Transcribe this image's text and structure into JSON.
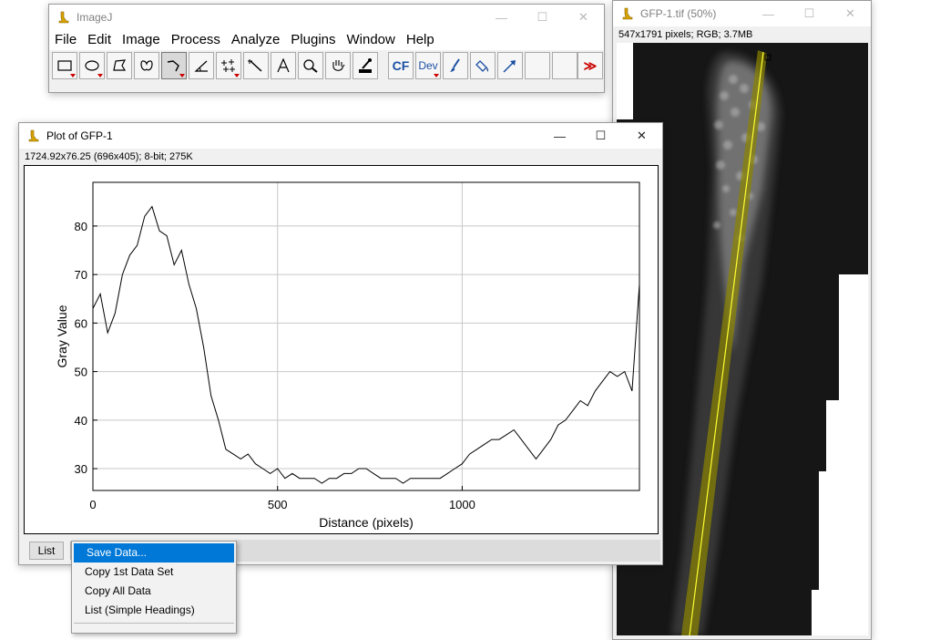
{
  "imagej": {
    "title": "ImageJ",
    "menus": [
      "File",
      "Edit",
      "Image",
      "Process",
      "Analyze",
      "Plugins",
      "Window",
      "Help"
    ],
    "tool_cf": "CF",
    "tool_dev": "Dev",
    "overflow": "≫"
  },
  "image_window": {
    "title": "GFP-1.tif (50%)",
    "info": "547x1791 pixels; RGB; 3.7MB"
  },
  "plot_window": {
    "title": "Plot of GFP-1",
    "info": "1724.92x76.25   (696x405); 8-bit; 275K",
    "list_button": "List"
  },
  "context_menu": {
    "items": [
      "Save Data...",
      "Copy 1st Data Set",
      "Copy All Data",
      "List (Simple Headings)"
    ],
    "selected_index": 0
  },
  "chart_data": {
    "type": "line",
    "xlabel": "Distance (pixels)",
    "ylabel": "Gray Value",
    "xlim": [
      0,
      1480
    ],
    "ylim": [
      25.5,
      89
    ],
    "xticks": [
      0,
      500,
      1000
    ],
    "yticks": [
      30,
      40,
      50,
      60,
      70,
      80
    ],
    "grid": true,
    "series": [
      {
        "x": [
          0,
          20,
          40,
          60,
          80,
          100,
          120,
          140,
          160,
          180,
          200,
          220,
          240,
          260,
          280,
          300,
          320,
          340,
          360,
          380,
          400,
          420,
          440,
          460,
          480,
          500,
          520,
          540,
          560,
          580,
          600,
          620,
          640,
          660,
          680,
          700,
          720,
          740,
          760,
          780,
          800,
          820,
          840,
          860,
          880,
          900,
          920,
          940,
          960,
          980,
          1000,
          1020,
          1040,
          1060,
          1080,
          1100,
          1120,
          1140,
          1160,
          1180,
          1200,
          1220,
          1240,
          1260,
          1280,
          1300,
          1320,
          1340,
          1360,
          1380,
          1400,
          1420,
          1440,
          1460,
          1480
        ],
        "values": [
          63,
          66,
          58,
          62,
          70,
          74,
          76,
          82,
          84,
          79,
          78,
          72,
          75,
          68,
          63,
          55,
          45,
          40,
          34,
          33,
          32,
          33,
          31,
          30,
          29,
          30,
          28,
          29,
          28,
          28,
          28,
          27,
          28,
          28,
          29,
          29,
          30,
          30,
          29,
          28,
          28,
          28,
          27,
          28,
          28,
          28,
          28,
          28,
          29,
          30,
          31,
          33,
          34,
          35,
          36,
          36,
          37,
          38,
          36,
          34,
          32,
          34,
          36,
          39,
          40,
          42,
          44,
          43,
          46,
          48,
          50,
          49,
          50,
          46,
          68
        ]
      }
    ]
  }
}
